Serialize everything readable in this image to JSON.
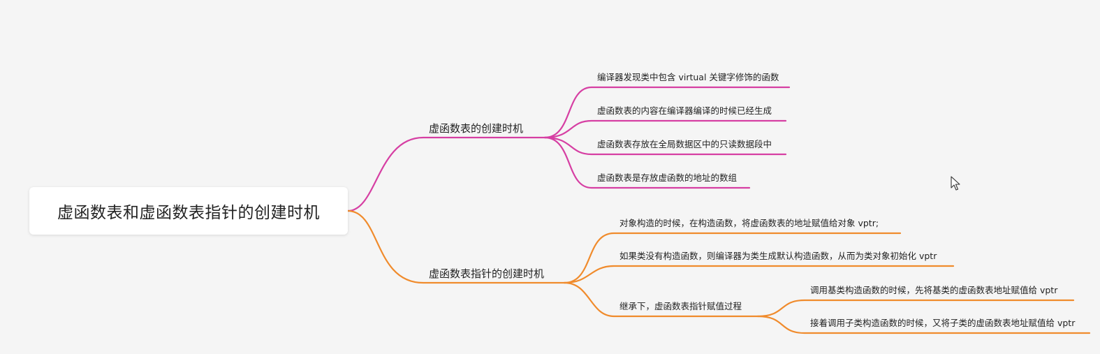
{
  "root": {
    "label": "虚函数表和虚函数表指针的创建时机"
  },
  "branches": [
    {
      "label": "虚函数表的创建时机",
      "color": "#d63fa3",
      "children": [
        {
          "label": "编译器发现类中包含 virtual 关键字修饰的函数"
        },
        {
          "label": "虚函数表的内容在编译器编译的时候已经生成"
        },
        {
          "label": "虚函数表存放在全局数据区中的只读数据段中"
        },
        {
          "label": "虚函数表是存放虚函数的地址的数组"
        }
      ]
    },
    {
      "label": "虚函数表指针的创建时机",
      "color": "#f08b2c",
      "children": [
        {
          "label": "对象构造的时候，在构造函数，将虚函数表的地址赋值给对象 vptr;"
        },
        {
          "label": "如果类没有构造函数，则编译器为类生成默认构造函数，从而为类对象初始化 vptr"
        },
        {
          "label": "继承下，虚函数表指针赋值过程",
          "children": [
            {
              "label": "调用基类构造函数的时候，先将基类的虚函数表地址赋值给 vptr"
            },
            {
              "label": "接着调用子类构造函数的时候，又将子类的虚函数表地址赋值给 vptr"
            }
          ]
        }
      ]
    }
  ],
  "cursor": {
    "icon": "mouse-pointer-icon"
  }
}
